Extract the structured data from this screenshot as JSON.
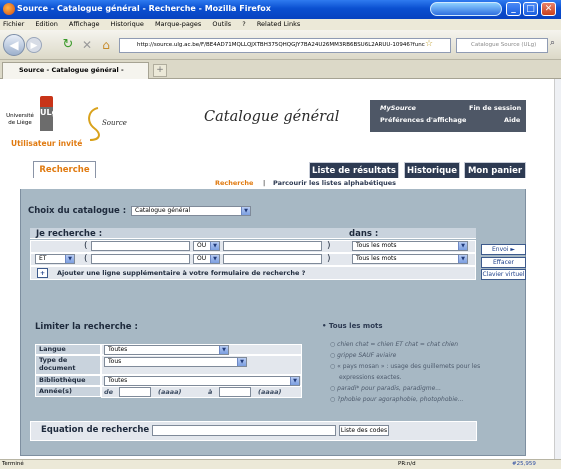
{
  "window": {
    "title": "Source - Catalogue général - Recherche - Mozilla Firefox"
  },
  "menubar": [
    "Fichier",
    "Edition",
    "Affichage",
    "Historique",
    "Marque-pages",
    "Outils",
    "?",
    "Related Links"
  ],
  "navbar": {
    "url": "http://source.ulg.ac.be/F/BE4AD71MQLLQJXTBH375QHQGJY7BA24U26MM3RB6BSU6L2ARUU-10946?func",
    "search_placeholder": "Catalogue Source (ULg)"
  },
  "tabs": [
    {
      "label": "Source - Catalogue général - Recher..."
    }
  ],
  "status": {
    "left": "Terminé",
    "right": "PR:n/d",
    "extra": "#25,959"
  },
  "header": {
    "ulg": "Université de Liège",
    "ulg_mark": "ULg",
    "source_logo": "Source",
    "catalog_title": "Catalogue général",
    "my_source": "MySource",
    "end_session": "Fin de session",
    "display_prefs": "Préférences d'affichage",
    "help": "Aide",
    "user": "Utilisateur invité"
  },
  "page_tabs": {
    "recherche": "Recherche",
    "results": "Liste de résultats",
    "history": "Historique",
    "cart": "Mon panier"
  },
  "subnav": {
    "active": "Recherche",
    "sep": "|",
    "browse": "Parcourir les listes alphabétiques"
  },
  "catalog_choice": {
    "label": "Choix du catalogue :",
    "value": "Catalogue général"
  },
  "search": {
    "je_recherche": "Je recherche :",
    "dans": "dans :",
    "open_paren": "(",
    "close_paren": ")",
    "rows": [
      {
        "bool": "",
        "op": "OU",
        "field": "Tous les mots"
      },
      {
        "bool": "ET",
        "op": "OU",
        "field": "Tous les mots"
      }
    ],
    "add_line_icon": "+",
    "add_line": "Ajouter une ligne supplémentaire à votre formulaire de recherche ?",
    "submit": "Envoi ►",
    "clear": "Effacer",
    "keyboard": "Clavier virtuel"
  },
  "limits": {
    "title": "Limiter la recherche :",
    "langue_label": "Langue",
    "langue_value": "Toutes",
    "type_label": "Type de document",
    "type_value": "Tous",
    "lib_label": "Bibliothèque",
    "lib_value": "Toutes",
    "year_label": "Année(s)",
    "de": "de",
    "a": "à",
    "aaaa": "(aaaa)"
  },
  "help_panel": {
    "title": "Tous les mots",
    "lines": [
      "chien chat = chien ET chat = chat chien",
      "grippe SAUF aviaire",
      "« pays mosan » : usage des guillemets pour les",
      "expressions exactes.",
      "paradi* pour paradis, paradigme...",
      "?phobie pour agoraphobie, photophobie..."
    ]
  },
  "equation": {
    "label": "Equation de recherche :",
    "codes": "Liste des codes"
  }
}
